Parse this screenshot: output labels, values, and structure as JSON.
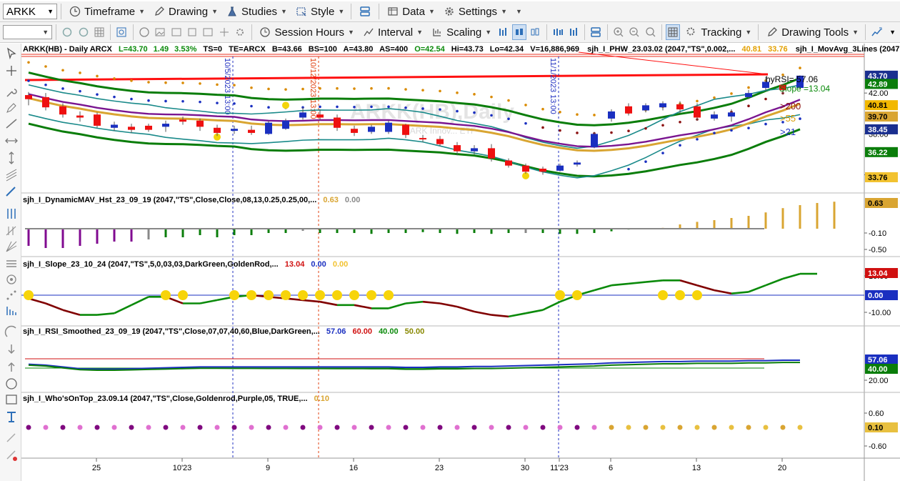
{
  "toolbar1": {
    "symbol": "ARKK",
    "timeframe": "Timeframe",
    "drawing": "Drawing",
    "studies": "Studies",
    "style": "Style",
    "data": "Data",
    "settings": "Settings"
  },
  "toolbar2": {
    "session_hours": "Session Hours",
    "interval": "Interval",
    "scaling": "Scaling",
    "tracking": "Tracking",
    "drawing_tools": "Drawing Tools"
  },
  "price_header": {
    "symbol": "ARKK(HB) - Daily  ARCX",
    "last": "L=43.70",
    "change": "1.49",
    "pct": "3.53%",
    "ts": "TS=0",
    "te": "TE=ARCX",
    "bid": "B=43.66",
    "bs": "BS=100",
    "ask": "A=43.80",
    "as": "AS=400",
    "open": "O=42.54",
    "high": "Hi=43.73",
    "low": "Lo=42.34",
    "vol": "V=16,886,969",
    "study1": "sjh_I_PHW_23.03.02 (2047,\"TS\",0.002,...",
    "study1_v1": "40.81",
    "study1_v2": "33.76",
    "study2": "sjh_I_MovAvg_3Lines (2047,\"T..."
  },
  "watermark": {
    "title": "ARKK(HB),Daily",
    "sub": "ARK Innov... ETF"
  },
  "annotations": {
    "rsi": "hyRSI= 57.06",
    "slope": "Slope =13.04",
    "gt200": ">200",
    "gt55": ">55",
    "gt21": ">21",
    "vline1": "10/5/2023 13:00",
    "vline2": "10/12/2023 13:00",
    "vline3": "11/1/2023 13:00"
  },
  "price_axis": {
    "ticks": [
      "42.00",
      "38.00",
      "34.00"
    ],
    "badges": [
      {
        "value": "43.70",
        "bg": "#1a2f8f",
        "fg": "#ffffff"
      },
      {
        "value": "42.89",
        "bg": "#0a7d0a",
        "fg": "#ffffff"
      },
      {
        "value": "40.81",
        "bg": "#f2b800",
        "fg": "#000000"
      },
      {
        "value": "39.70",
        "bg": "#d9a532",
        "fg": "#000000"
      },
      {
        "value": "38.45",
        "bg": "#1a2f8f",
        "fg": "#ffffff"
      },
      {
        "value": "36.22",
        "bg": "#0a7d0a",
        "fg": "#ffffff"
      },
      {
        "value": "33.76",
        "bg": "#f2c230",
        "fg": "#000000"
      }
    ]
  },
  "panel2": {
    "title": "sjh_I_DynamicMAV_Hst_23_09_19 (2047,\"TS\",Close,Close,08,13,0.25,0.25,00,...",
    "v1": "0.63",
    "v2": "0.00",
    "ticks": [
      "-0.10",
      "-0.50"
    ],
    "badge": "0.63",
    "values": [
      -0.4,
      -0.45,
      -0.45,
      -0.4,
      -0.35,
      -0.3,
      -0.3,
      -0.25,
      -0.2,
      -0.2,
      -0.15,
      -0.2,
      -0.15,
      -0.15,
      -0.1,
      -0.1,
      -0.05,
      -0.1,
      -0.1,
      -0.1,
      -0.12,
      -0.1,
      -0.1,
      -0.08,
      -0.1,
      -0.12,
      -0.1,
      -0.12,
      -0.1,
      -0.1,
      -0.1,
      -0.12,
      -0.12,
      -0.1,
      -0.06,
      -0.02,
      0.0,
      0.02,
      0.1,
      0.16,
      0.2,
      0.25,
      0.3,
      0.38,
      0.48,
      0.55,
      0.6,
      0.63
    ]
  },
  "panel3": {
    "title": "sjh_I_Slope_23_10_24 (2047,\"TS\",5,0,03,03,DarkGreen,GoldenRod,...",
    "v1": "13.04",
    "v2": "0.00",
    "v3": "0.00",
    "ticks": [
      "10.00",
      "-10.00"
    ],
    "badges": [
      {
        "value": "13.04",
        "bg": "#d01010"
      },
      {
        "value": "0.00",
        "bg": "#1a2fc0"
      }
    ]
  },
  "panel4": {
    "title": "sjh_I_RSI_Smoothed_23_09_19 (2047,\"TS\",Close,07,07,40,60,Blue,DarkGreen,...",
    "v1": "57.06",
    "v2": "60.00",
    "v3": "40.00",
    "v4": "50.00",
    "ticks": [
      "20.00"
    ],
    "badges": [
      {
        "value": "57.06",
        "bg": "#1a2fc0"
      },
      {
        "value": "40.00",
        "bg": "#0a7d0a"
      }
    ]
  },
  "panel5": {
    "title": "sjh_I_Who'sOnTop_23.09.14 (2047,\"TS\",Close,Goldenrod,Purple,05,  TRUE,...",
    "v1": "0.10",
    "ticks": [
      "0.60",
      "-0.60"
    ],
    "badge": "0.10"
  },
  "x_axis": {
    "labels": [
      {
        "text": "25",
        "x": 105
      },
      {
        "text": "10'23",
        "x": 225
      },
      {
        "text": "9",
        "x": 345
      },
      {
        "text": "16",
        "x": 465
      },
      {
        "text": "23",
        "x": 585
      },
      {
        "text": "30",
        "x": 705
      },
      {
        "text": "11'23",
        "x": 753
      },
      {
        "text": "6",
        "x": 825
      },
      {
        "text": "13",
        "x": 945
      },
      {
        "text": "20",
        "x": 1065
      }
    ]
  },
  "chart_data": {
    "type": "candlestick",
    "title": "ARKK(HB) - Daily",
    "ylim": [
      32.5,
      45.3
    ],
    "candles": [
      {
        "o": 41.8,
        "c": 41.4,
        "h": 42.1,
        "l": 40.8,
        "d": "dn"
      },
      {
        "o": 41.6,
        "c": 40.6,
        "h": 42.0,
        "l": 40.3,
        "d": "dn"
      },
      {
        "o": 40.7,
        "c": 39.9,
        "h": 41.0,
        "l": 39.6,
        "d": "dn"
      },
      {
        "o": 39.8,
        "c": 39.6,
        "h": 40.2,
        "l": 39.2,
        "d": "dn"
      },
      {
        "o": 39.9,
        "c": 38.8,
        "h": 40.1,
        "l": 38.6,
        "d": "dn"
      },
      {
        "o": 38.9,
        "c": 38.6,
        "h": 39.2,
        "l": 38.3,
        "d": "up"
      },
      {
        "o": 38.7,
        "c": 38.4,
        "h": 39.0,
        "l": 38.1,
        "d": "dn"
      },
      {
        "o": 38.8,
        "c": 38.4,
        "h": 39.0,
        "l": 38.2,
        "d": "dn"
      },
      {
        "o": 38.7,
        "c": 39.0,
        "h": 39.3,
        "l": 38.2,
        "d": "up"
      },
      {
        "o": 39.4,
        "c": 39.2,
        "h": 39.7,
        "l": 38.9,
        "d": "dn"
      },
      {
        "o": 39.3,
        "c": 38.7,
        "h": 39.5,
        "l": 38.3,
        "d": "dn"
      },
      {
        "o": 38.6,
        "c": 38.1,
        "h": 38.9,
        "l": 37.8,
        "d": "dn"
      },
      {
        "o": 38.3,
        "c": 38.5,
        "h": 38.8,
        "l": 38.0,
        "d": "up"
      },
      {
        "o": 38.4,
        "c": 38.1,
        "h": 38.8,
        "l": 37.9,
        "d": "dn"
      },
      {
        "o": 38.0,
        "c": 39.1,
        "h": 39.3,
        "l": 37.9,
        "d": "up"
      },
      {
        "o": 38.5,
        "c": 39.3,
        "h": 39.5,
        "l": 38.4,
        "d": "up"
      },
      {
        "o": 39.6,
        "c": 40.1,
        "h": 40.6,
        "l": 39.4,
        "d": "up"
      },
      {
        "o": 39.9,
        "c": 39.6,
        "h": 40.4,
        "l": 39.3,
        "d": "dn"
      },
      {
        "o": 39.6,
        "c": 38.6,
        "h": 39.9,
        "l": 38.3,
        "d": "dn"
      },
      {
        "o": 38.5,
        "c": 38.1,
        "h": 38.8,
        "l": 37.8,
        "d": "dn"
      },
      {
        "o": 38.2,
        "c": 38.7,
        "h": 38.9,
        "l": 38.0,
        "d": "up"
      },
      {
        "o": 38.2,
        "c": 39.1,
        "h": 39.3,
        "l": 38.0,
        "d": "up"
      },
      {
        "o": 38.9,
        "c": 37.9,
        "h": 39.0,
        "l": 37.6,
        "d": "dn"
      },
      {
        "o": 37.6,
        "c": 37.6,
        "h": 37.9,
        "l": 37.2,
        "d": "dn"
      },
      {
        "o": 37.5,
        "c": 37.0,
        "h": 37.8,
        "l": 36.8,
        "d": "dn"
      },
      {
        "o": 36.9,
        "c": 36.3,
        "h": 37.2,
        "l": 35.9,
        "d": "dn"
      },
      {
        "o": 36.6,
        "c": 36.3,
        "h": 36.9,
        "l": 36.0,
        "d": "up"
      },
      {
        "o": 36.6,
        "c": 35.6,
        "h": 37.0,
        "l": 35.3,
        "d": "dn"
      },
      {
        "o": 35.4,
        "c": 34.9,
        "h": 35.6,
        "l": 34.7,
        "d": "dn"
      },
      {
        "o": 34.9,
        "c": 34.3,
        "h": 35.1,
        "l": 34.1,
        "d": "dn"
      },
      {
        "o": 34.6,
        "c": 34.3,
        "h": 34.8,
        "l": 34.0,
        "d": "dn"
      },
      {
        "o": 34.4,
        "c": 34.9,
        "h": 35.1,
        "l": 34.3,
        "d": "up"
      },
      {
        "o": 35.2,
        "c": 35.0,
        "h": 35.4,
        "l": 34.8,
        "d": "up"
      },
      {
        "o": 36.7,
        "c": 38.0,
        "h": 38.2,
        "l": 36.6,
        "d": "up"
      },
      {
        "o": 39.5,
        "c": 40.2,
        "h": 40.4,
        "l": 39.2,
        "d": "up"
      },
      {
        "o": 40.7,
        "c": 40.0,
        "h": 41.0,
        "l": 39.8,
        "d": "dn"
      },
      {
        "o": 40.3,
        "c": 40.8,
        "h": 41.0,
        "l": 40.1,
        "d": "up"
      },
      {
        "o": 40.6,
        "c": 41.0,
        "h": 41.2,
        "l": 40.3,
        "d": "up"
      },
      {
        "o": 40.9,
        "c": 40.4,
        "h": 41.2,
        "l": 40.0,
        "d": "dn"
      },
      {
        "o": 40.7,
        "c": 39.6,
        "h": 41.0,
        "l": 39.3,
        "d": "dn"
      },
      {
        "o": 39.5,
        "c": 39.9,
        "h": 40.2,
        "l": 39.3,
        "d": "up"
      },
      {
        "o": 39.7,
        "c": 40.1,
        "h": 40.4,
        "l": 39.2,
        "d": "up"
      },
      {
        "o": 41.6,
        "c": 42.0,
        "h": 42.3,
        "l": 41.4,
        "d": "up"
      },
      {
        "o": 42.5,
        "c": 43.1,
        "h": 43.6,
        "l": 42.2,
        "d": "up"
      },
      {
        "o": 42.8,
        "c": 42.3,
        "h": 42.9,
        "l": 41.9,
        "d": "dn"
      },
      {
        "o": 42.5,
        "c": 43.7,
        "h": 43.73,
        "l": 42.34,
        "d": "up"
      }
    ]
  }
}
